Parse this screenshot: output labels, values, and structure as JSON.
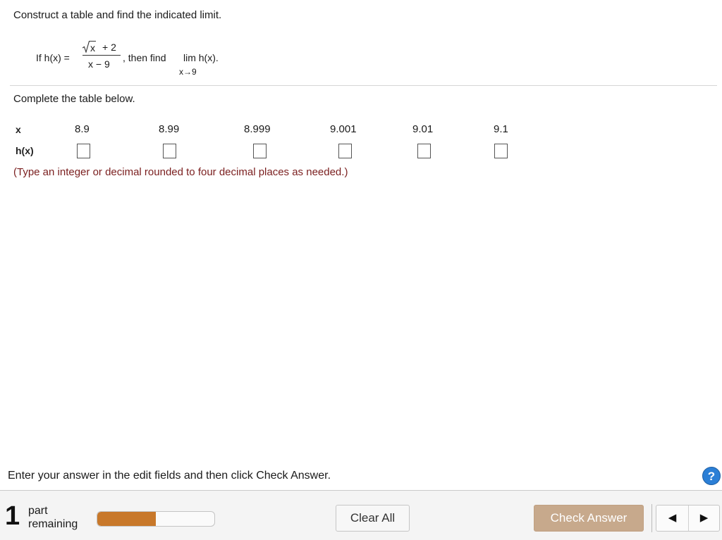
{
  "question": {
    "prompt": "Construct a table and find the indicated limit.",
    "formula": {
      "lead": "If h(x) =",
      "numerator_radicand": "x",
      "numerator_rest": "+ 2",
      "denominator": "x − 9",
      "then": ", then find",
      "limit": "lim h(x).",
      "limit_sub": "x→9"
    },
    "table_intro": "Complete the table below.",
    "table": {
      "x_label": "x",
      "h_label": "h(x)",
      "x_values": [
        "8.9",
        "8.99",
        "8.999",
        "9.001",
        "9.01",
        "9.1"
      ],
      "h_values": [
        "",
        "",
        "",
        "",
        "",
        ""
      ]
    },
    "hint": "(Type an integer or decimal rounded to four decimal places as needed.)"
  },
  "footer": {
    "instruction": "Enter your answer in the edit fields and then click Check Answer.",
    "help_label": "?",
    "parts_remaining_count": "1",
    "parts_label_line1": "part",
    "parts_label_line2": "remaining",
    "progress_fraction": 0.5,
    "clear_label": "Clear All",
    "check_label": "Check Answer",
    "prev_icon": "◀",
    "next_icon": "▶"
  },
  "colors": {
    "hint_text": "#7a1e1e",
    "progress_fill": "#c8782a",
    "check_button": "#c7a98c",
    "help_button": "#2b7fd6"
  }
}
